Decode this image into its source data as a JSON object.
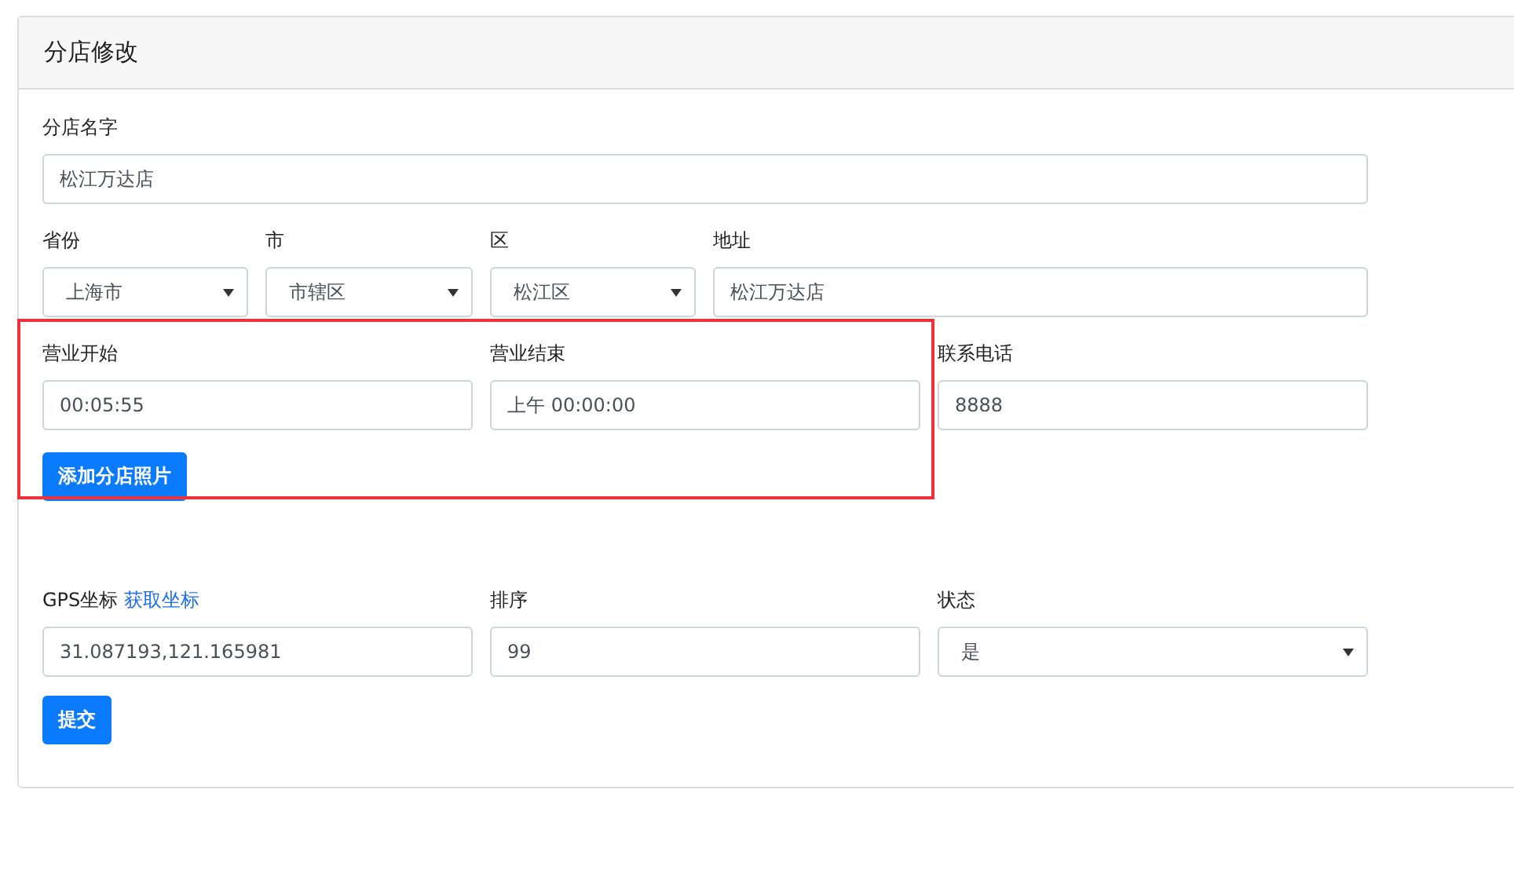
{
  "card": {
    "title": "分店修改"
  },
  "name_field": {
    "label": "分店名字",
    "value": "松江万达店"
  },
  "location_row": [
    {
      "kind": "select",
      "label": "省份",
      "value": "上海市"
    },
    {
      "kind": "select",
      "label": "市",
      "value": "市辖区"
    },
    {
      "kind": "select",
      "label": "区",
      "value": "松江区"
    },
    {
      "kind": "input",
      "label": "地址",
      "value": "松江万达店"
    }
  ],
  "hours_row": [
    {
      "label": "营业开始",
      "value": "00:05:55"
    },
    {
      "label": "营业结束",
      "value": "上午 00:00:00"
    }
  ],
  "phone_field": {
    "label": "联系电话",
    "value": "8888"
  },
  "add_photo_button": "添加分店照片",
  "bottom_row": [
    {
      "kind": "input",
      "label": "GPS坐标",
      "link": "获取坐标",
      "value": "31.087193,121.165981"
    },
    {
      "kind": "input",
      "label": "排序",
      "value": "99"
    },
    {
      "kind": "select",
      "label": "状态",
      "value": "是"
    }
  ],
  "submit_button": "提交"
}
